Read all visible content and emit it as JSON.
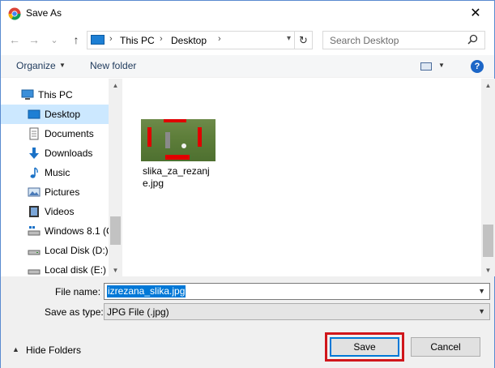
{
  "window": {
    "title": "Save As",
    "close_glyph": "✕"
  },
  "nav": {
    "back_glyph": "←",
    "forward_glyph": "→",
    "recent_glyph": "⌄",
    "up_glyph": "↑",
    "breadcrumb": [
      "This PC",
      "Desktop"
    ],
    "refresh_glyph": "↻",
    "search_placeholder": "Search Desktop"
  },
  "toolbar": {
    "organize_label": "Organize",
    "new_folder_label": "New folder",
    "help_glyph": "?"
  },
  "sidebar": {
    "items": [
      {
        "label": "This PC",
        "icon": "pc-icon"
      },
      {
        "label": "Desktop",
        "icon": "desktop-icon",
        "selected": true
      },
      {
        "label": "Documents",
        "icon": "documents-icon"
      },
      {
        "label": "Downloads",
        "icon": "downloads-icon"
      },
      {
        "label": "Music",
        "icon": "music-icon"
      },
      {
        "label": "Pictures",
        "icon": "pictures-icon"
      },
      {
        "label": "Videos",
        "icon": "videos-icon"
      },
      {
        "label": "Windows 8.1 (C",
        "icon": "drive-icon"
      },
      {
        "label": "Local Disk (D:)",
        "icon": "drive-icon"
      },
      {
        "label": "Local disk (E:)",
        "icon": "drive-icon"
      }
    ]
  },
  "files": [
    {
      "name": "slika_za_rezanje.jpg",
      "type": "image"
    }
  ],
  "form": {
    "filename_label": "File name:",
    "filename_value": "izrezana_slika.jpg",
    "savetype_label": "Save as type:",
    "savetype_value": "JPG File (.jpg)"
  },
  "footer": {
    "hide_folders_label": "Hide Folders",
    "save_label": "Save",
    "cancel_label": "Cancel"
  },
  "colors": {
    "accent": "#0078d7",
    "highlight": "#d0161b",
    "selection": "#cce8ff"
  }
}
